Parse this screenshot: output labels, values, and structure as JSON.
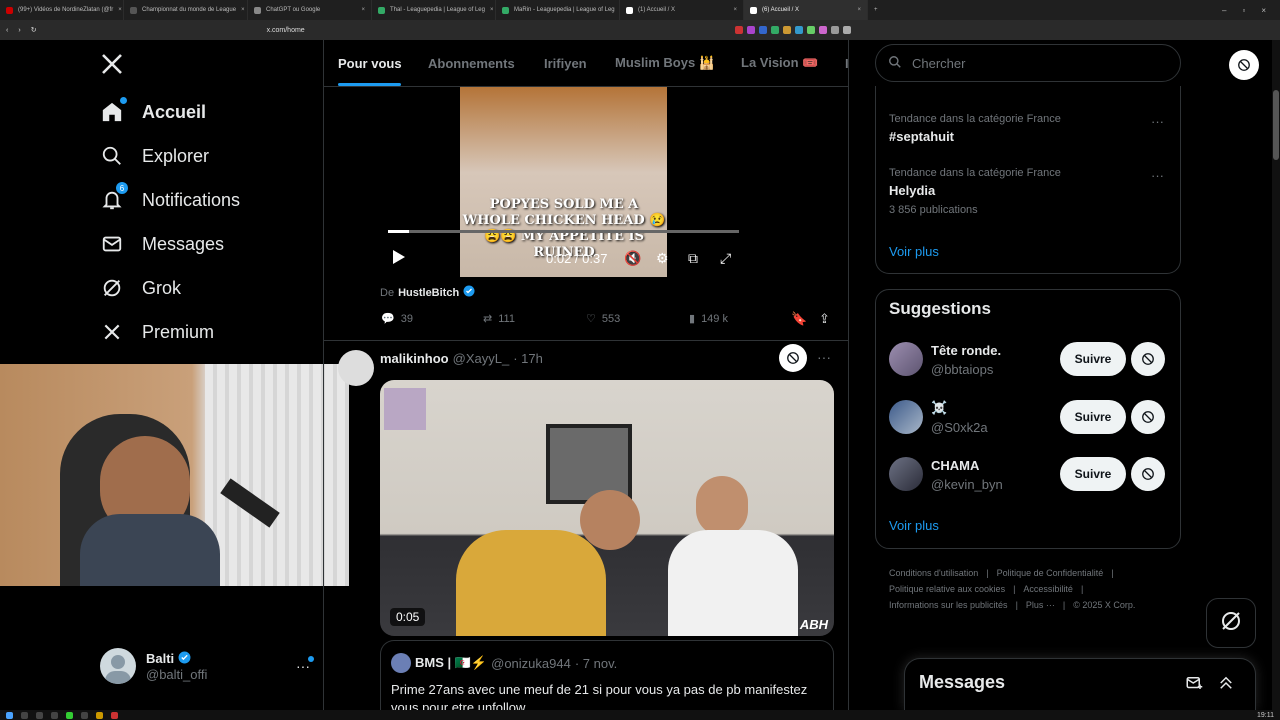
{
  "browser": {
    "tabs": [
      {
        "title": "(99+) Vidéos de NordineZlatan (@fr"
      },
      {
        "title": "Championnat du monde de League"
      },
      {
        "title": "ChatGPT ou Google"
      },
      {
        "title": "Thal - Leaguepedia | League of Leg"
      },
      {
        "title": "MaRin - Leaguepedia | League of Leg"
      },
      {
        "title": "(1) Accueil / X"
      },
      {
        "title": "(6) Accueil / X"
      }
    ],
    "url": "x.com/home",
    "clock": "19:11"
  },
  "nav": {
    "home": "Accueil",
    "explore": "Explorer",
    "notifications": "Notifications",
    "notif_count": "6",
    "messages": "Messages",
    "grok": "Grok",
    "premium": "Premium"
  },
  "account": {
    "name": "Balti",
    "handle": "@balti_offi"
  },
  "feed_tabs": [
    "Pour vous",
    "Abonnements",
    "Irifiyen",
    "Muslim Boys 🕌",
    "La Vision 🎟️",
    "I"
  ],
  "post1": {
    "video_caption": "POPYES SOLD ME A WHOLE CHICKEN HEAD 😢😩😩 MY APPETITE IS RUINED",
    "time": "0:02 / 0:37",
    "from_label": "De",
    "from_name": "HustleBitch",
    "replies": "39",
    "reposts": "111",
    "likes": "553",
    "views": "149 k"
  },
  "post2": {
    "author": "malikinhoo",
    "handle": "@XayyL_",
    "time": "· 17h",
    "video_duration": "0:05",
    "watermark": "ABH",
    "quote_author": "BMS | 🇩🇿⚡",
    "quote_handle": "@onizuka944",
    "quote_time": "· 7 nov.",
    "quote_text": "Prime 27ans avec une meuf de 21 si pour vous ya pas de pb manifestez vous pour etre unfollow"
  },
  "search": {
    "placeholder": "Chercher"
  },
  "trends": {
    "items": [
      {
        "category": "Tendance dans la catégorie France",
        "name": "#septahuit",
        "count": ""
      },
      {
        "category": "Tendance dans la catégorie France",
        "name": "Helydia",
        "count": "3 856 publications"
      }
    ],
    "see_more": "Voir plus"
  },
  "suggestions": {
    "title": "Suggestions",
    "users": [
      {
        "name": "Tête ronde.",
        "handle": "@bbtaiops",
        "follow": "Suivre"
      },
      {
        "name": "☠️",
        "handle": "@S0xk2a",
        "follow": "Suivre"
      },
      {
        "name": "CHAMA",
        "handle": "@kevin_byn",
        "follow": "Suivre"
      }
    ],
    "see_more": "Voir plus"
  },
  "footer": {
    "links": [
      "Conditions d'utilisation",
      "Politique de Confidentialité",
      "Politique relative aux cookies",
      "Accessibilité",
      "Informations sur les publicités",
      "Plus ···"
    ],
    "copyright": "© 2025 X Corp."
  },
  "messages_drawer": {
    "title": "Messages"
  },
  "colors": {
    "accent": "#1d9bf0",
    "background": "#000000",
    "border": "#2f3336",
    "muted": "#71767b"
  }
}
